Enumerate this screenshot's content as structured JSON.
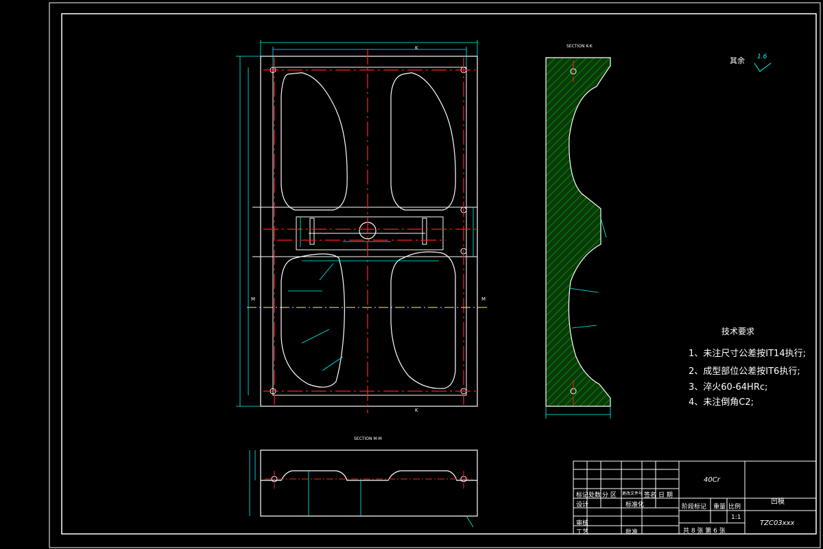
{
  "drawing": {
    "section_kk_label": "SECTION K-K",
    "section_mm_label": "SECTION M-M",
    "marker_k": "K",
    "marker_m": "M",
    "surface_rest_label": "其余",
    "surface_rest_value": "1.6",
    "colors": {
      "outline": "#ffffff",
      "dimension": "#00ffff",
      "centerline": "#ff2020",
      "hatch": "#00c000",
      "hatch_fill": "#0a3a0a",
      "frame": "#ffffff"
    }
  },
  "tech_requirements": {
    "title": "技术要求",
    "items": [
      "1、未注尺寸公差按IT14执行;",
      "2、成型部位公差按IT6执行;",
      "3、淬火60-64HRc;",
      "4、未注倒角C2;"
    ]
  },
  "title_block": {
    "material": "40Cr",
    "part_name": "凹模",
    "drawing_number": "TZC03xxx",
    "scale": "1:1",
    "headers_row": [
      "标记",
      "处数",
      "分 区",
      "更改文件号",
      "签名",
      "日 期"
    ],
    "design_label": "设计",
    "standardize_label": "标准化",
    "stage_mark_label": "阶段标记",
    "weight_label": "重量",
    "scale_label": "比例",
    "review_label": "审核",
    "process_label": "工艺",
    "approve_label": "批准",
    "sheets_text": "共 8 张  第 6 张"
  }
}
